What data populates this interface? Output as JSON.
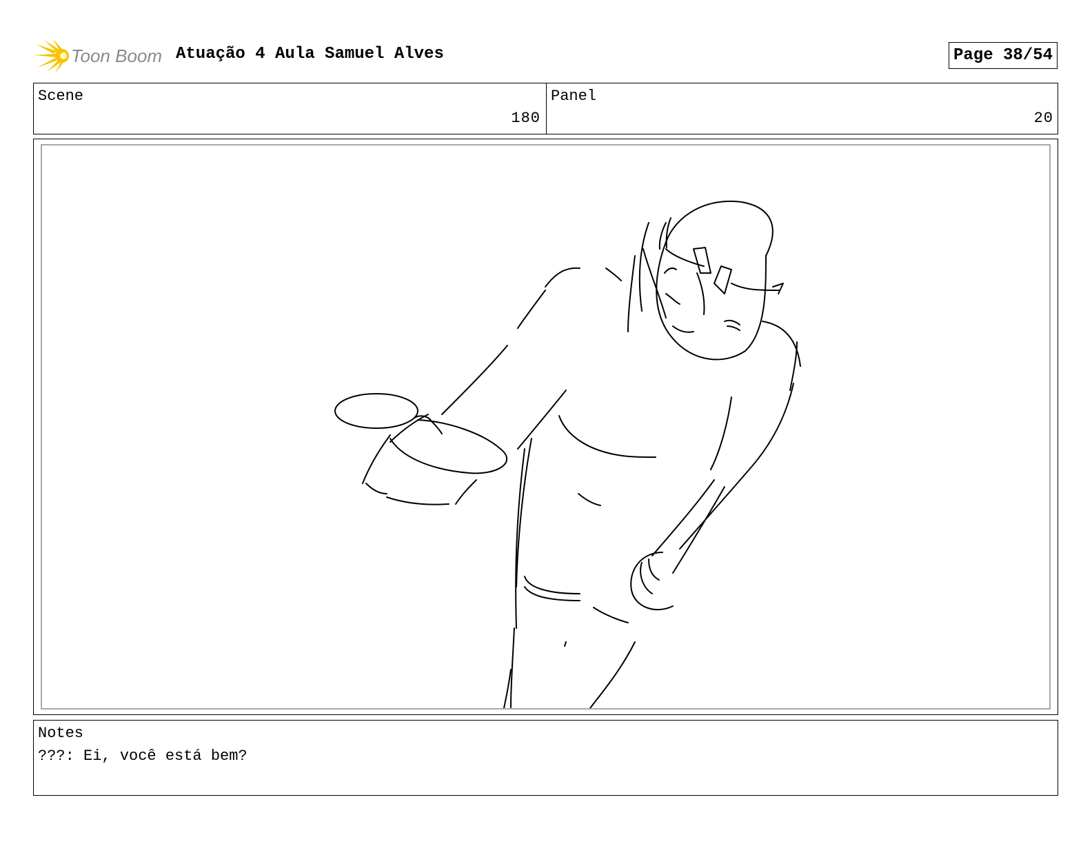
{
  "header": {
    "logo_text": "Toon Boom",
    "project_title": "Atuação 4 Aula Samuel Alves",
    "page_label": "Page 38/54"
  },
  "info": {
    "scene_label": "Scene",
    "scene_value": "180",
    "panel_label": "Panel",
    "panel_value": "20"
  },
  "notes": {
    "label": "Notes",
    "text": "???: Ei, você está bem?"
  },
  "colors": {
    "logo_accent": "#f5c400",
    "logo_text": "#8a8a8a",
    "inner_frame": "#a8a8a8"
  }
}
